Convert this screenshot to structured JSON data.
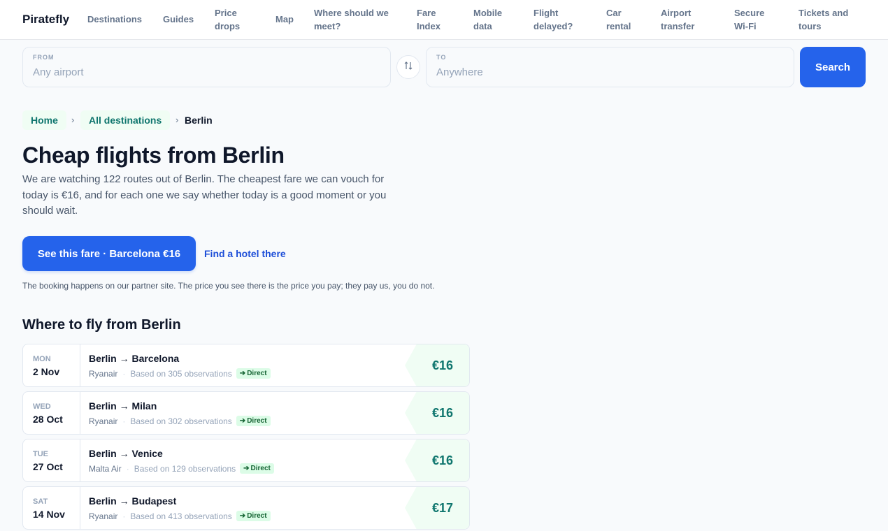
{
  "brand": "Piratefly",
  "nav": [
    "Destinations",
    "Guides",
    "Price drops",
    "Map",
    "Where should we meet?",
    "Fare Index",
    "Mobile data",
    "Flight delayed?",
    "Car rental",
    "Airport transfer",
    "Secure Wi-Fi",
    "Tickets and tours"
  ],
  "search": {
    "from_label": "FROM",
    "from_placeholder": "Any airport",
    "to_label": "TO",
    "to_placeholder": "Anywhere",
    "button": "Search"
  },
  "breadcrumb": {
    "home": "Home",
    "all": "All destinations",
    "sep": "›",
    "current": "Berlin"
  },
  "hero": {
    "title": "Cheap flights from Berlin",
    "intro": "We are watching 122 routes out of Berlin. The cheapest fare we can vouch for today is €16, and for each one we say whether today is a good moment or you should wait.",
    "cta": "See this fare · Barcelona €16",
    "hotel": "Find a hotel there",
    "disclaimer": "The booking happens on our partner site. The price you see there is the price you pay; they pay us, you do not."
  },
  "section_title": "Where to fly from Berlin",
  "routes": [
    {
      "day": "MON",
      "date": "2 Nov",
      "from": "Berlin",
      "arrow": "→",
      "to": "Barcelona",
      "airline": "Ryanair",
      "obs": "Based on 305 observations",
      "badge": "Direct",
      "price": "€16"
    },
    {
      "day": "WED",
      "date": "28 Oct",
      "from": "Berlin",
      "arrow": "→",
      "to": "Milan",
      "airline": "Ryanair",
      "obs": "Based on 302 observations",
      "badge": "Direct",
      "price": "€16"
    },
    {
      "day": "TUE",
      "date": "27 Oct",
      "from": "Berlin",
      "arrow": "→",
      "to": "Venice",
      "airline": "Malta Air",
      "obs": "Based on 129 observations",
      "badge": "Direct",
      "price": "€16"
    },
    {
      "day": "SAT",
      "date": "14 Nov",
      "from": "Berlin",
      "arrow": "→",
      "to": "Budapest",
      "airline": "Ryanair",
      "obs": "Based on 413 observations",
      "badge": "Direct",
      "price": "€17"
    }
  ],
  "colors": {
    "accent": "#2563eb",
    "price": "#0f766e",
    "badge_bg": "#dcfce7",
    "badge_text": "#166534"
  },
  "icons": {
    "swap": "swap-arrows-icon",
    "direct": "arrow-right-icon"
  }
}
